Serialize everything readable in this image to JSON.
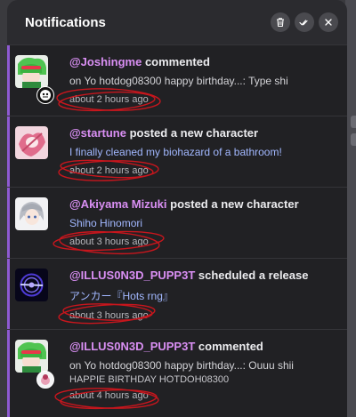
{
  "panel": {
    "title": "Notifications",
    "actions": [
      {
        "name": "delete-all",
        "icon": "trash-icon"
      },
      {
        "name": "mark-all-read",
        "icon": "double-check-icon"
      },
      {
        "name": "close",
        "icon": "close-icon"
      }
    ]
  },
  "notifications": [
    {
      "user": "@Joshingme",
      "action": "commented",
      "detail": "on Yo hotdog08300 happy birthday...: Type shi",
      "time": "about 2 hours ago"
    },
    {
      "user": "@startune",
      "action": "posted a new character",
      "detail": "I finally cleaned my biohazard of a bathroom!",
      "time": "about 2 hours ago"
    },
    {
      "user": "@Akiyama Mizuki",
      "action": "posted a new character",
      "detail": "Shiho Hinomori",
      "time": "about 3 hours ago"
    },
    {
      "user": "@ILLUS0N3D_PUPP3T",
      "action": "scheduled a release",
      "detail": "アンカー『Hots rng』",
      "time": "about 3 hours ago"
    },
    {
      "user": "@ILLUS0N3D_PUPP3T",
      "action": "commented",
      "detail": "on Yo hotdog08300 happy birthday...: Ouuu shii",
      "detail2": "HAPPIE BIRTHDAY HOTDOH08300",
      "time": "about 4 hours ago"
    }
  ],
  "colors": {
    "accent": "#8e5ad2",
    "username": "#d98ff3",
    "link": "#a2b8ff",
    "scribble": "#c8161d"
  }
}
